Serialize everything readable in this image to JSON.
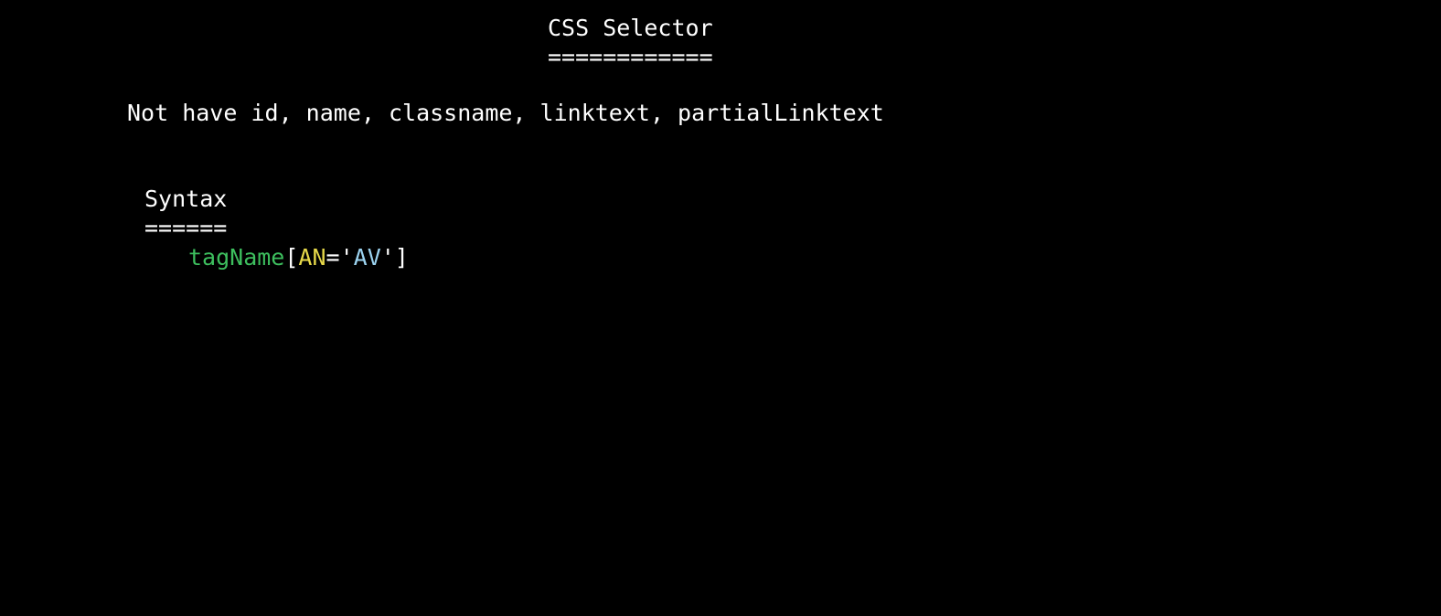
{
  "slide": {
    "title": "CSS Selector",
    "title_underline": "============",
    "note": "Not have id, name, classname, linktext, partialLinktext",
    "syntax": {
      "heading": "Syntax",
      "underline": "======",
      "code": {
        "tag": "tagName",
        "open_bracket": "[",
        "attr_name": "AN",
        "equals_quote": "='",
        "attr_value": "AV",
        "close": "']"
      }
    }
  },
  "colors": {
    "background": "#000000",
    "text": "#ffffff",
    "tag": "#3dbf5e",
    "attr_name": "#e6d84a",
    "attr_value": "#9cd3f0"
  }
}
